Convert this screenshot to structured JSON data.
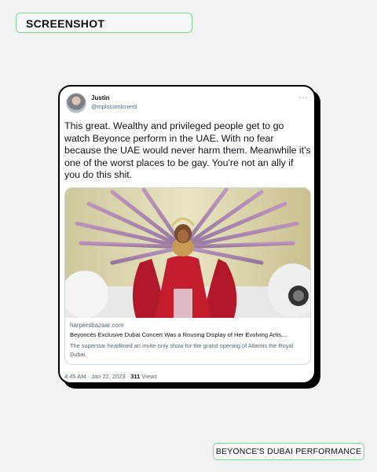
{
  "header_label": "SCREENSHOT",
  "tweet": {
    "author_name": "Justin",
    "author_handle": "@mplscomicnerd",
    "text": "This great.  Wealthy and privileged people get to go watch Beyonce perform in the UAE. With no fear because the UAE would never harm them.  Meanwhile it's one of the worst places to be gay. You're not an ally if you do this shit.",
    "link_card": {
      "domain": "harpersbazaar.com",
      "title": "Beyoncés Exclusive Dubai Concert Was a Rousing Display of Her Evolving Artis...",
      "description": "The superstar headlined an invite-only show for the grand opening of Atlantis the Royal Dubai."
    },
    "timestamp": "4:45 AM · Jan 22, 2023 · ",
    "views_count": "311",
    "views_label": " Views"
  },
  "footer_label": "BEYONCE'S DUBAI PERFORMANCE",
  "icons": {
    "avatar": "avatar",
    "more": "more-icon"
  }
}
